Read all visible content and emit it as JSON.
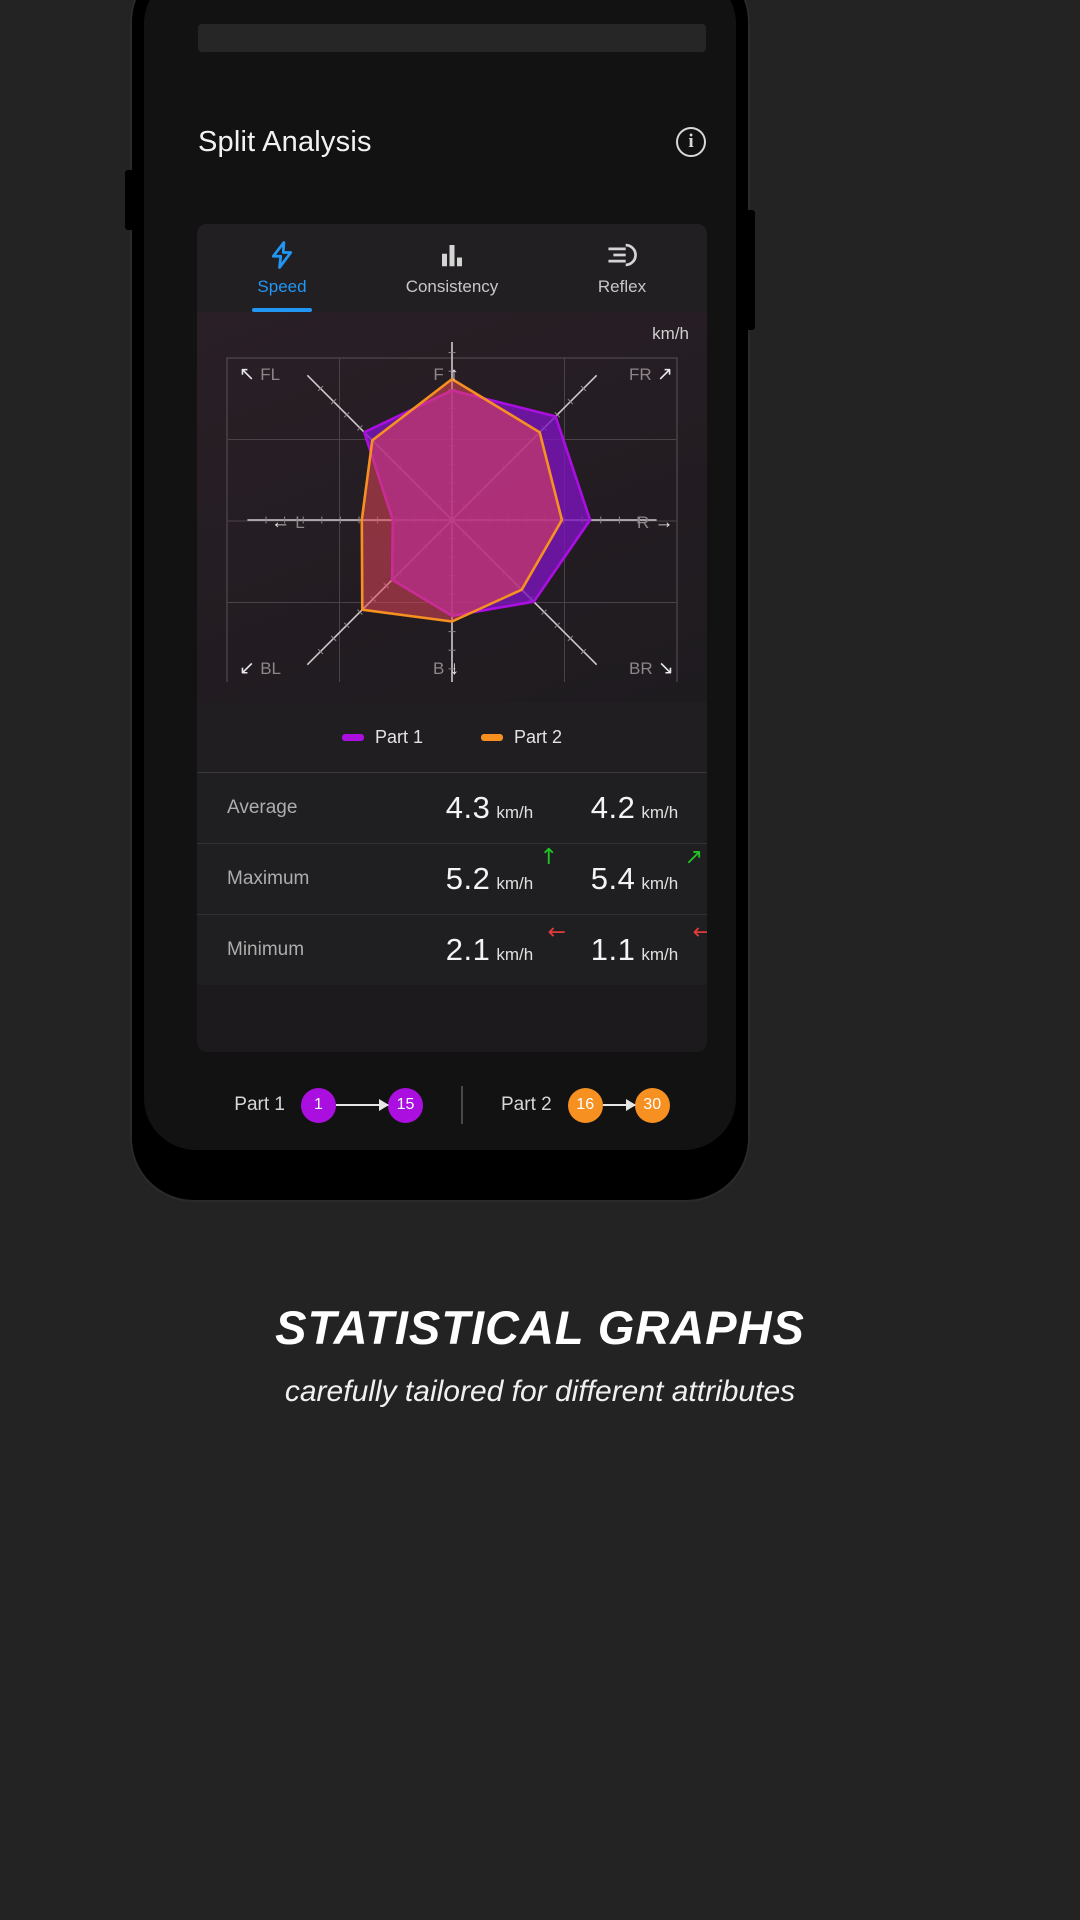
{
  "header": {
    "title": "Split Analysis",
    "info_icon": "info-circle-icon"
  },
  "tabs": [
    {
      "label": "Speed",
      "icon": "lightning-bolt-icon",
      "active": true
    },
    {
      "label": "Consistency",
      "icon": "bar-chart-icon",
      "active": false
    },
    {
      "label": "Reflex",
      "icon": "reflex-meter-icon",
      "active": false
    }
  ],
  "chart_unit": "km/h",
  "legend": [
    {
      "label": "Part 1",
      "color": "#aa0fe0"
    },
    {
      "label": "Part 2",
      "color": "#f59021"
    }
  ],
  "stats": {
    "rows": [
      {
        "label": "Average",
        "part1": {
          "value": "4.3",
          "unit": "km/h",
          "trend": ""
        },
        "part2": {
          "value": "4.2",
          "unit": "km/h",
          "trend": ""
        }
      },
      {
        "label": "Maximum",
        "part1": {
          "value": "5.2",
          "unit": "km/h",
          "trend": "↑"
        },
        "part2": {
          "value": "5.4",
          "unit": "km/h",
          "trend": "↗"
        }
      },
      {
        "label": "Minimum",
        "part1": {
          "value": "2.1",
          "unit": "km/h",
          "trend": "←"
        },
        "part2": {
          "value": "1.1",
          "unit": "km/h",
          "trend": "←"
        }
      }
    ]
  },
  "parts_range": {
    "part1": {
      "name": "Part 1",
      "start": "1",
      "end": "15",
      "color": "#aa0fe0"
    },
    "part2": {
      "name": "Part 2",
      "start": "16",
      "end": "30",
      "color": "#f59021"
    }
  },
  "caption": {
    "title": "STATISTICAL GRAPHS",
    "subtitle": "carefully tailored for different attributes"
  },
  "chart_data": {
    "type": "radar",
    "title": "",
    "unit": "km/h",
    "grid": true,
    "legend_position": "bottom",
    "axis_labels": [
      "FL",
      "F",
      "FR",
      "R",
      "BR",
      "B",
      "BL",
      "L"
    ],
    "axis_label_arrows": [
      "↖",
      "↑",
      "↗",
      "→",
      "↘",
      "↓",
      "↙",
      "←"
    ],
    "categories": [
      "F",
      "FR",
      "R",
      "BR",
      "B",
      "BL",
      "L",
      "FL"
    ],
    "rlim": [
      0,
      5.5
    ],
    "series": [
      {
        "name": "Part 1",
        "color": "#aa0fe0",
        "values": [
          4.6,
          5.2,
          4.9,
          4.1,
          3.4,
          3.0,
          2.1,
          4.4
        ]
      },
      {
        "name": "Part 2",
        "color": "#f59021",
        "values": [
          5.0,
          4.4,
          3.9,
          3.5,
          3.6,
          4.5,
          3.2,
          4.0
        ]
      }
    ]
  }
}
